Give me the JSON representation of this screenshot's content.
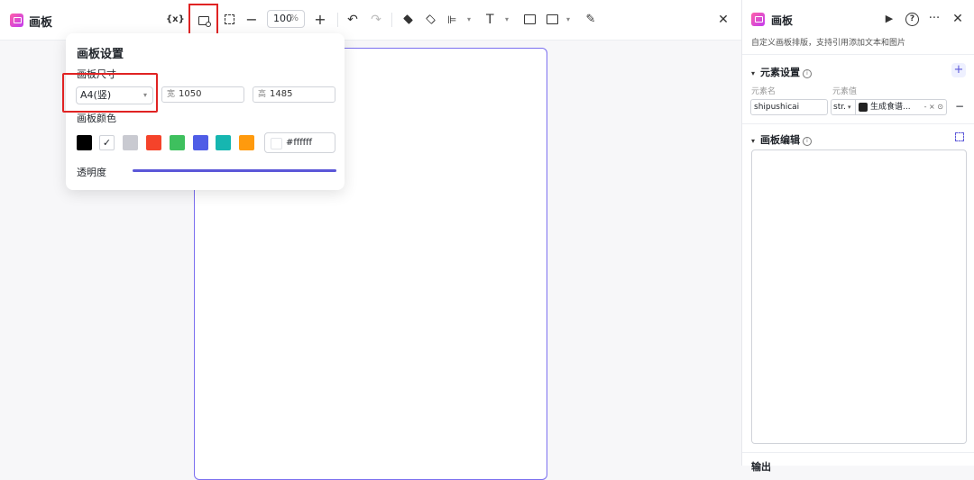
{
  "app": {
    "title": "画板"
  },
  "toolbar": {
    "variable_label": "{x}",
    "zoom_value": "100",
    "zoom_unit": "%",
    "zoom_out": "−",
    "zoom_in": "+",
    "undo": "↶",
    "redo": "↷",
    "text_tool": "T",
    "pen_tool": "✎",
    "close": "✕"
  },
  "canvas_settings": {
    "title": "画板设置",
    "size_label": "画板尺寸",
    "size_value": "A4(竖)",
    "width_key": "宽",
    "width_value": "1050",
    "height_key": "高",
    "height_value": "1485",
    "color_label": "画板颜色",
    "swatches": [
      {
        "color": "#000000",
        "selected": false
      },
      {
        "color": "#ffffff",
        "selected": true
      },
      {
        "color": "#c9cad1",
        "selected": false
      },
      {
        "color": "#f5432a",
        "selected": false
      },
      {
        "color": "#3ec05e",
        "selected": false
      },
      {
        "color": "#4f5de6",
        "selected": false
      },
      {
        "color": "#16b6b0",
        "selected": false
      },
      {
        "color": "#ff9a0d",
        "selected": false
      }
    ],
    "selected_check": "✓",
    "hex_value": "#ffffff",
    "opacity_label": "透明度",
    "opacity": 1.0
  },
  "panel": {
    "title": "画板",
    "run": "▶",
    "help": "?",
    "more": "···",
    "close": "✕",
    "description": "自定义画板排版，支持引用添加文本和图片",
    "element_section": {
      "title": "元素设置",
      "add": "+",
      "col_name": "元素名",
      "col_value": "元素值",
      "row": {
        "name": "shipushicai",
        "type": "str.",
        "type_arrow": "▾",
        "value": "生成食谱...",
        "tail": "- × ⊙",
        "remove": "−"
      }
    },
    "editor_section": {
      "title": "画板编辑"
    },
    "output_section": {
      "title": "输出"
    },
    "caret": "▾",
    "info": "i"
  }
}
